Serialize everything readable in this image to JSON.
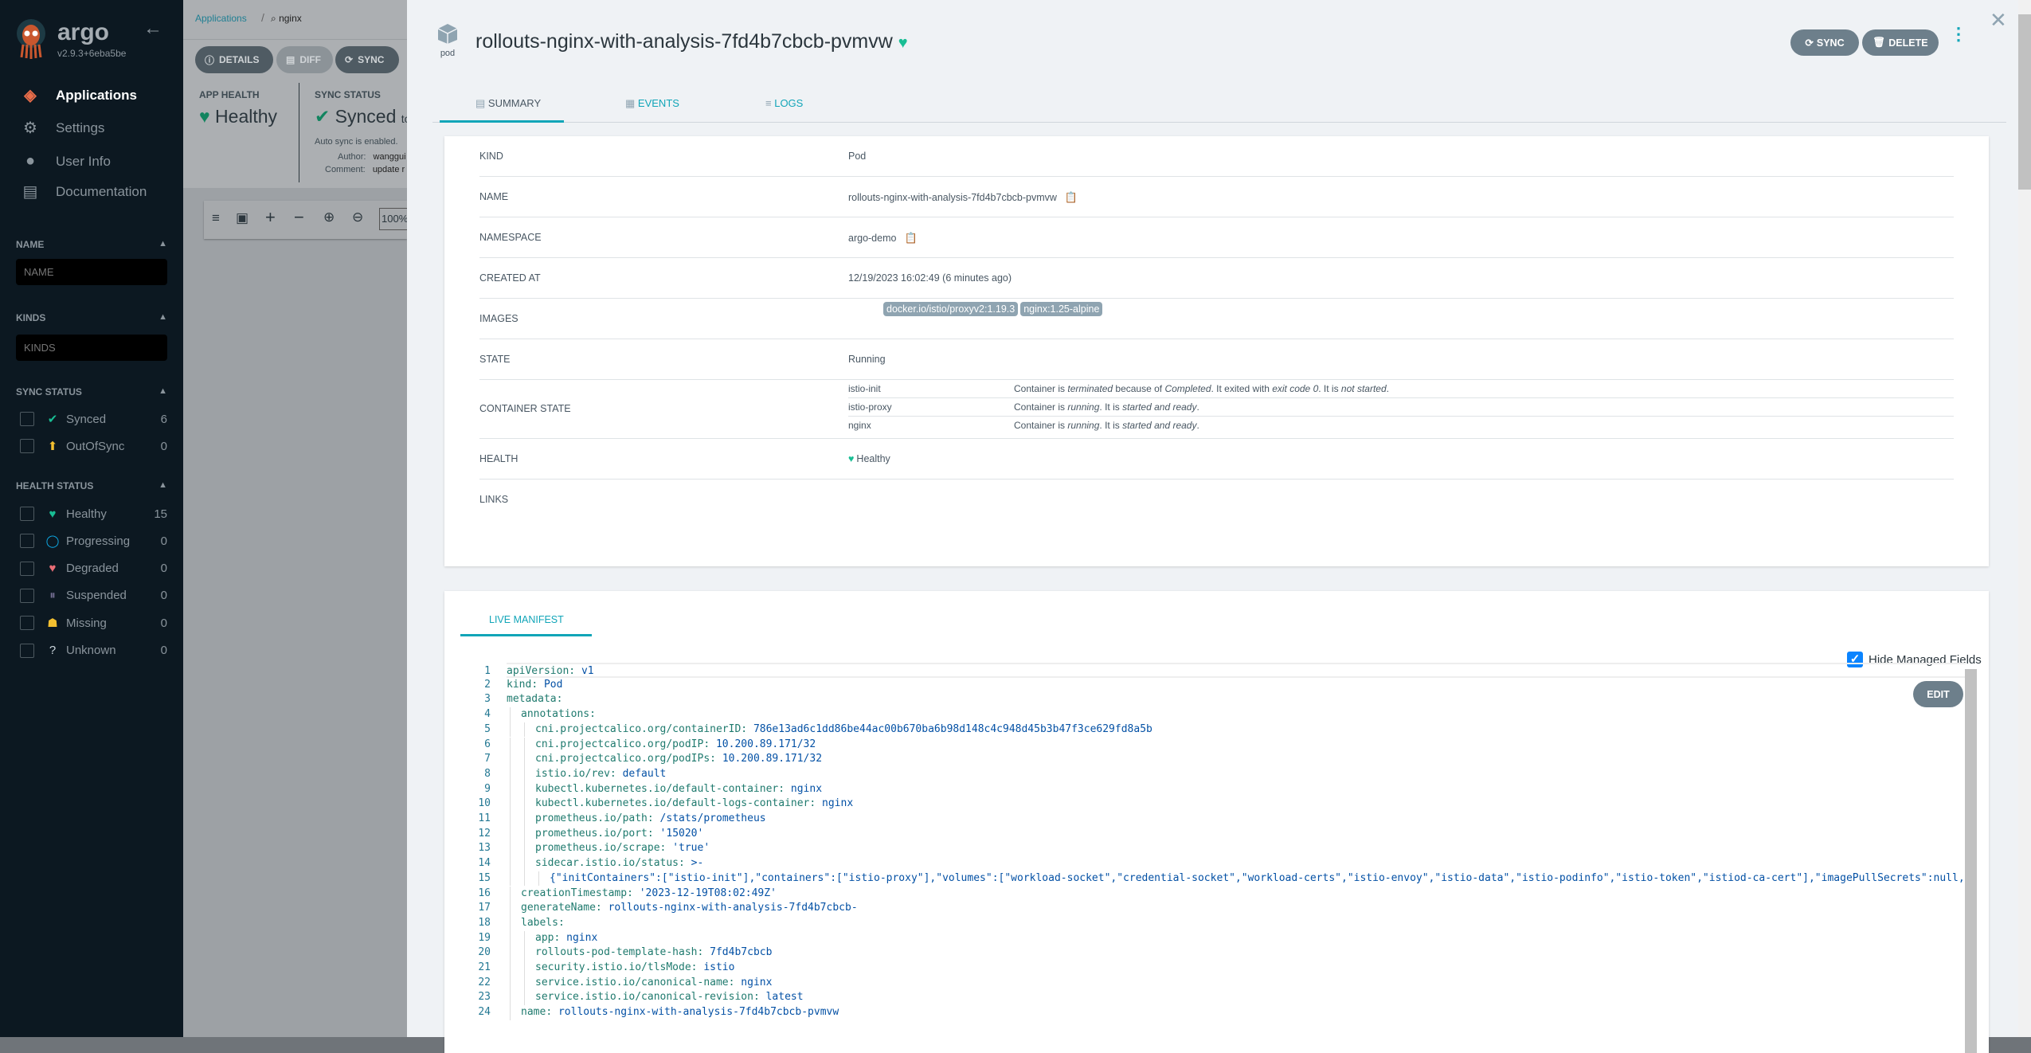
{
  "sidebar": {
    "brand": "argo",
    "version": "v2.9.3+6eba5be",
    "nav": [
      {
        "label": "Applications",
        "icon": "layers-icon"
      },
      {
        "label": "Settings",
        "icon": "gear-icon"
      },
      {
        "label": "User Info",
        "icon": "user-icon"
      },
      {
        "label": "Documentation",
        "icon": "book-icon"
      }
    ],
    "name_filter": {
      "title": "NAME",
      "placeholder": "NAME"
    },
    "kinds_filter": {
      "title": "KINDS",
      "placeholder": "KINDS"
    },
    "sync_status": {
      "title": "SYNC STATUS",
      "items": [
        {
          "label": "Synced",
          "count": "6",
          "icon": "check-circle-icon",
          "color": "#18be94"
        },
        {
          "label": "OutOfSync",
          "count": "0",
          "icon": "arrow-up-circle-icon",
          "color": "#f4c030"
        }
      ]
    },
    "health_status": {
      "title": "HEALTH STATUS",
      "items": [
        {
          "label": "Healthy",
          "count": "15",
          "icon": "heart-icon",
          "color": "#18be94"
        },
        {
          "label": "Progressing",
          "count": "0",
          "icon": "circle-notch-icon",
          "color": "#0dadea"
        },
        {
          "label": "Degraded",
          "count": "0",
          "icon": "heart-broken-icon",
          "color": "#e96d76"
        },
        {
          "label": "Suspended",
          "count": "0",
          "icon": "pause-circle-icon",
          "color": "#766f94"
        },
        {
          "label": "Missing",
          "count": "0",
          "icon": "ghost-icon",
          "color": "#f4c030"
        },
        {
          "label": "Unknown",
          "count": "0",
          "icon": "question-circle-icon",
          "color": "#ccd6dd"
        }
      ]
    }
  },
  "background": {
    "breadcrumb": "Applications",
    "search": "nginx",
    "buttons": [
      "DETAILS",
      "DIFF",
      "SYNC"
    ],
    "app_health_label": "APP HEALTH",
    "app_health": "Healthy",
    "sync_status_label": "SYNC STATUS",
    "sync_status": "Synced",
    "sync_suffix": "to",
    "auto_sync": "Auto sync is enabled.",
    "author_label": "Author:",
    "author": "wanggui",
    "comment_label": "Comment:",
    "comment": "update r",
    "zoom": "100%"
  },
  "panel": {
    "kind_label": "pod",
    "title": "rollouts-nginx-with-analysis-7fd4b7cbcb-pvmvw",
    "sync": "SYNC",
    "delete": "DELETE",
    "tabs": [
      {
        "label": "SUMMARY",
        "active": true
      },
      {
        "label": "EVENTS"
      },
      {
        "label": "LOGS"
      }
    ],
    "summary": {
      "kind": {
        "label": "KIND",
        "value": "Pod"
      },
      "name": {
        "label": "NAME",
        "value": "rollouts-nginx-with-analysis-7fd4b7cbcb-pvmvw"
      },
      "namespace": {
        "label": "NAMESPACE",
        "value": "argo-demo"
      },
      "created": {
        "label": "CREATED AT",
        "value": "12/19/2023 16:02:49  (6 minutes ago)"
      },
      "images": {
        "label": "IMAGES",
        "values": [
          "docker.io/istio/proxyv2:1.19.3",
          "nginx:1.25-alpine"
        ]
      },
      "state": {
        "label": "STATE",
        "value": "Running"
      },
      "container_state": {
        "label": "CONTAINER STATE",
        "items": [
          {
            "name": "istio-init",
            "parts": [
              "Container is ",
              "terminated",
              " because of ",
              "Completed",
              ". It exited with ",
              "exit code 0",
              ". It is ",
              "not started",
              "."
            ]
          },
          {
            "name": "istio-proxy",
            "parts": [
              "Container is ",
              "running",
              ". It is ",
              "started and ready",
              "."
            ]
          },
          {
            "name": "nginx",
            "parts": [
              "Container is ",
              "running",
              ". It is ",
              "started and ready",
              "."
            ]
          }
        ]
      },
      "health": {
        "label": "HEALTH",
        "value": "Healthy"
      },
      "links": {
        "label": "LINKS"
      }
    },
    "manifest": {
      "tab": "LIVE MANIFEST",
      "hide_managed": "Hide Managed Fields",
      "hide_checked": true,
      "edit": "EDIT",
      "lines": [
        {
          "i": 0,
          "k": "apiVersion",
          "v": "v1"
        },
        {
          "i": 0,
          "k": "kind",
          "v": "Pod"
        },
        {
          "i": 0,
          "k": "metadata",
          "v": ""
        },
        {
          "i": 1,
          "k": "annotations",
          "v": ""
        },
        {
          "i": 2,
          "k": "cni.projectcalico.org/containerID",
          "v": "786e13ad6c1dd86be44ac00b670ba6b98d148c4c948d45b3b47f3ce629fd8a5b"
        },
        {
          "i": 2,
          "k": "cni.projectcalico.org/podIP",
          "v": "10.200.89.171/32"
        },
        {
          "i": 2,
          "k": "cni.projectcalico.org/podIPs",
          "v": "10.200.89.171/32"
        },
        {
          "i": 2,
          "k": "istio.io/rev",
          "v": "default"
        },
        {
          "i": 2,
          "k": "kubectl.kubernetes.io/default-container",
          "v": "nginx"
        },
        {
          "i": 2,
          "k": "kubectl.kubernetes.io/default-logs-container",
          "v": "nginx"
        },
        {
          "i": 2,
          "k": "prometheus.io/path",
          "v": "/stats/prometheus"
        },
        {
          "i": 2,
          "k": "prometheus.io/port",
          "v": "'15020'"
        },
        {
          "i": 2,
          "k": "prometheus.io/scrape",
          "v": "'true'"
        },
        {
          "i": 2,
          "k": "sidecar.istio.io/status",
          "v": ">-"
        },
        {
          "i": 3,
          "k": "",
          "v": "{\"initContainers\":[\"istio-init\"],\"containers\":[\"istio-proxy\"],\"volumes\":[\"workload-socket\",\"credential-socket\",\"workload-certs\",\"istio-envoy\",\"istio-data\",\"istio-podinfo\",\"istio-token\",\"istiod-ca-cert\"],\"imagePullSecrets\":null,\"revision\":\"default\"}"
        },
        {
          "i": 1,
          "k": "creationTimestamp",
          "v": "'2023-12-19T08:02:49Z'"
        },
        {
          "i": 1,
          "k": "generateName",
          "v": "rollouts-nginx-with-analysis-7fd4b7cbcb-"
        },
        {
          "i": 1,
          "k": "labels",
          "v": ""
        },
        {
          "i": 2,
          "k": "app",
          "v": "nginx"
        },
        {
          "i": 2,
          "k": "rollouts-pod-template-hash",
          "v": "7fd4b7cbcb"
        },
        {
          "i": 2,
          "k": "security.istio.io/tlsMode",
          "v": "istio"
        },
        {
          "i": 2,
          "k": "service.istio.io/canonical-name",
          "v": "nginx"
        },
        {
          "i": 2,
          "k": "service.istio.io/canonical-revision",
          "v": "latest"
        },
        {
          "i": 1,
          "k": "name",
          "v": "rollouts-nginx-with-analysis-7fd4b7cbcb-pvmvw"
        }
      ]
    }
  },
  "colors": {
    "accent": "#11a5b8",
    "healthy": "#18be94",
    "button": "#6d7f8b"
  }
}
